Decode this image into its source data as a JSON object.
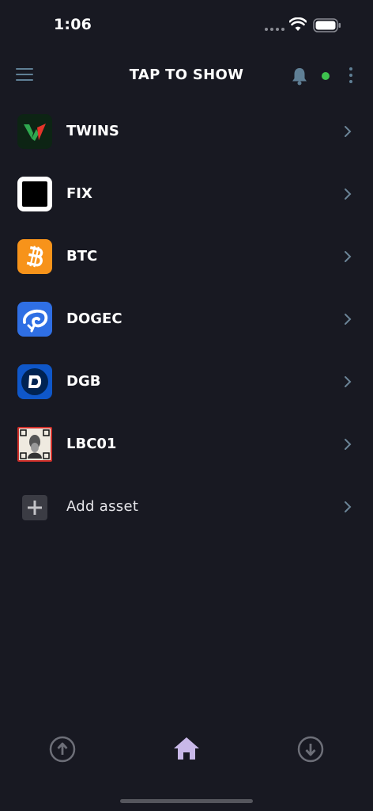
{
  "status_bar": {
    "time": "1:06"
  },
  "header": {
    "title": "TAP TO SHOW",
    "connection_color": "#3ec24e"
  },
  "assets": [
    {
      "name": "TWINS",
      "icon": "twins-logo-icon"
    },
    {
      "name": "FIX",
      "icon": "fix-logo-icon"
    },
    {
      "name": "BTC",
      "icon": "bitcoin-logo-icon"
    },
    {
      "name": "DOGEC",
      "icon": "dogecash-logo-icon"
    },
    {
      "name": "DGB",
      "icon": "digibyte-logo-icon"
    },
    {
      "name": "LBC01",
      "icon": "lbc01-portrait-icon"
    }
  ],
  "add_asset": {
    "label": "Add asset"
  },
  "bottom_nav": {
    "send": "arrow-up-circle-icon",
    "home": "home-icon",
    "receive": "arrow-down-circle-icon",
    "active_color": "#c8b8e8"
  }
}
